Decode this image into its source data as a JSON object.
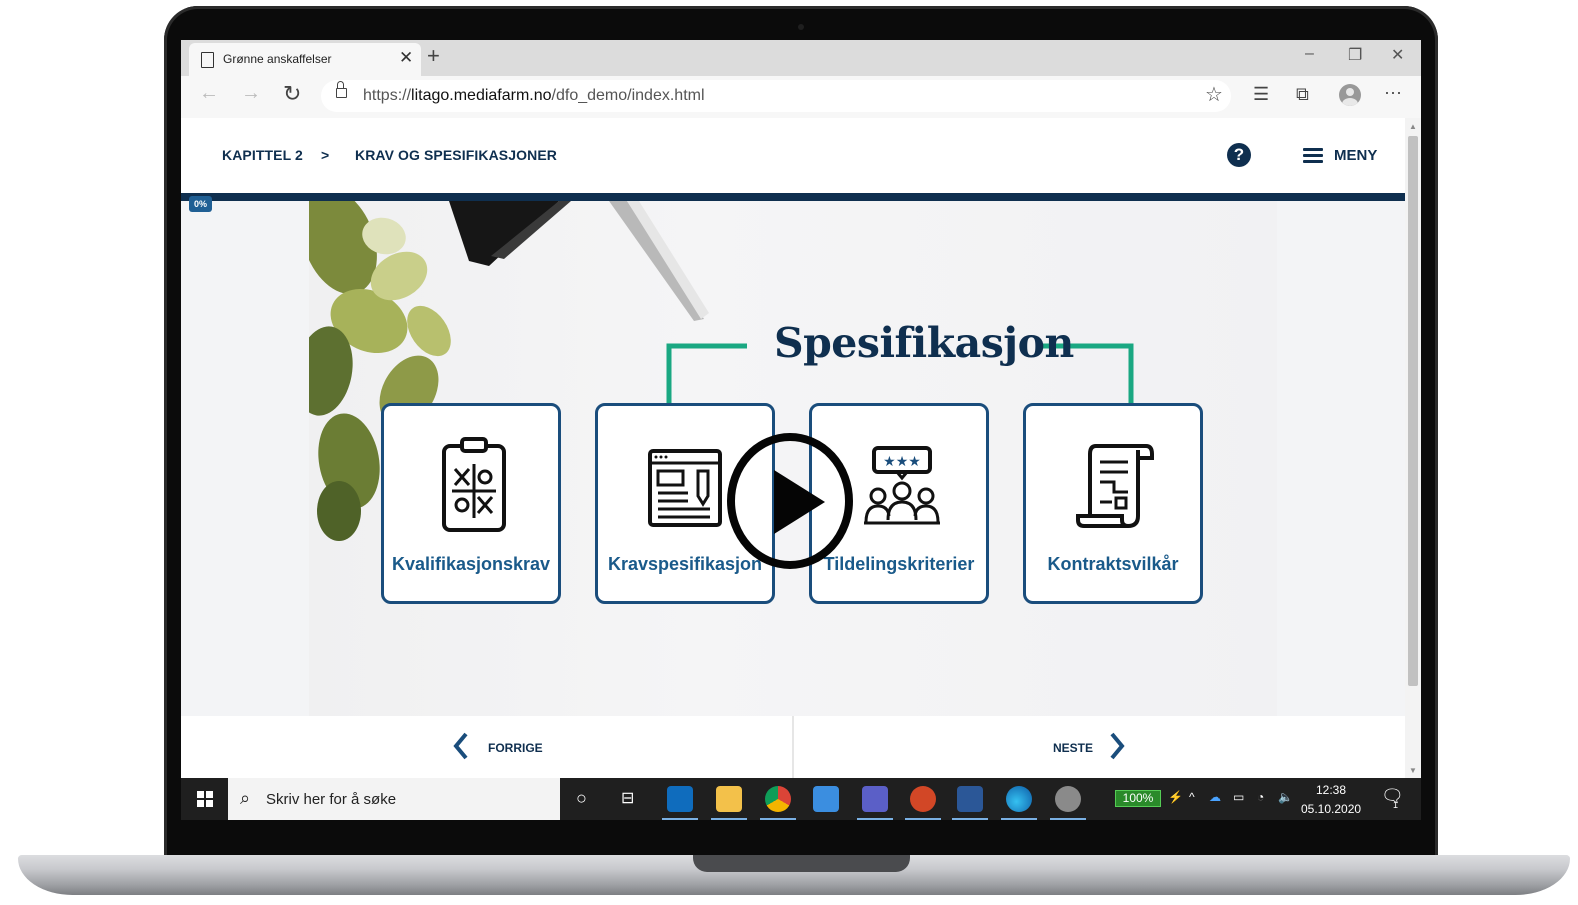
{
  "browser": {
    "tab_title": "Grønne anskaffelser",
    "tab_close": "✕",
    "new_tab": "+",
    "url_prefix": "https://",
    "url_host": "litago.mediafarm.no",
    "url_path": "/dfo_demo/index.html",
    "window_controls": [
      "–",
      "❐",
      "✕"
    ],
    "icons": [
      "back-icon",
      "forward-icon",
      "refresh-icon",
      "lock-icon",
      "favorite-star-icon",
      "favorites-list-icon",
      "collections-icon",
      "profile-icon",
      "more-icon"
    ]
  },
  "page": {
    "breadcrumb": {
      "chapter": "KAPITTEL 2",
      "separator": ">",
      "section": "KRAV OG SPESIFIKASJONER"
    },
    "help_label": "?",
    "menu_label": "MENY",
    "progress_label": "0%",
    "progress_value": 0,
    "video": {
      "title": "Spesifikasjon",
      "cards": [
        {
          "label": "Kvalifikasjonskrav",
          "icon": "tic-tac-toe-clipboard-icon"
        },
        {
          "label": "Kravspesifikasjon",
          "icon": "document-pen-icon"
        },
        {
          "label": "Tildelingskriterier",
          "icon": "rating-people-icon"
        },
        {
          "label": "Kontraktsvilkår",
          "icon": "scroll-contract-icon"
        }
      ],
      "play_icon": "play-icon"
    },
    "nav": {
      "prev_label": "FORRIGE",
      "next_label": "NESTE"
    }
  },
  "taskbar": {
    "search_placeholder": "Skriv her for å søke",
    "battery": "100%",
    "time": "12:38",
    "date": "05.10.2020",
    "notifications": "1",
    "apps": [
      "cortana-icon",
      "task-view-icon",
      "outlook-icon",
      "file-explorer-icon",
      "chrome-icon",
      "store-icon",
      "teams-icon",
      "powerpoint-icon",
      "word-icon",
      "edge-icon",
      "snip-icon"
    ]
  },
  "colors": {
    "navy": "#0f2f4f",
    "card_border": "#1a4d7c",
    "card_text": "#1a5a8a",
    "accent_green": "#1aa882",
    "taskbar": "#1f1f1f"
  }
}
